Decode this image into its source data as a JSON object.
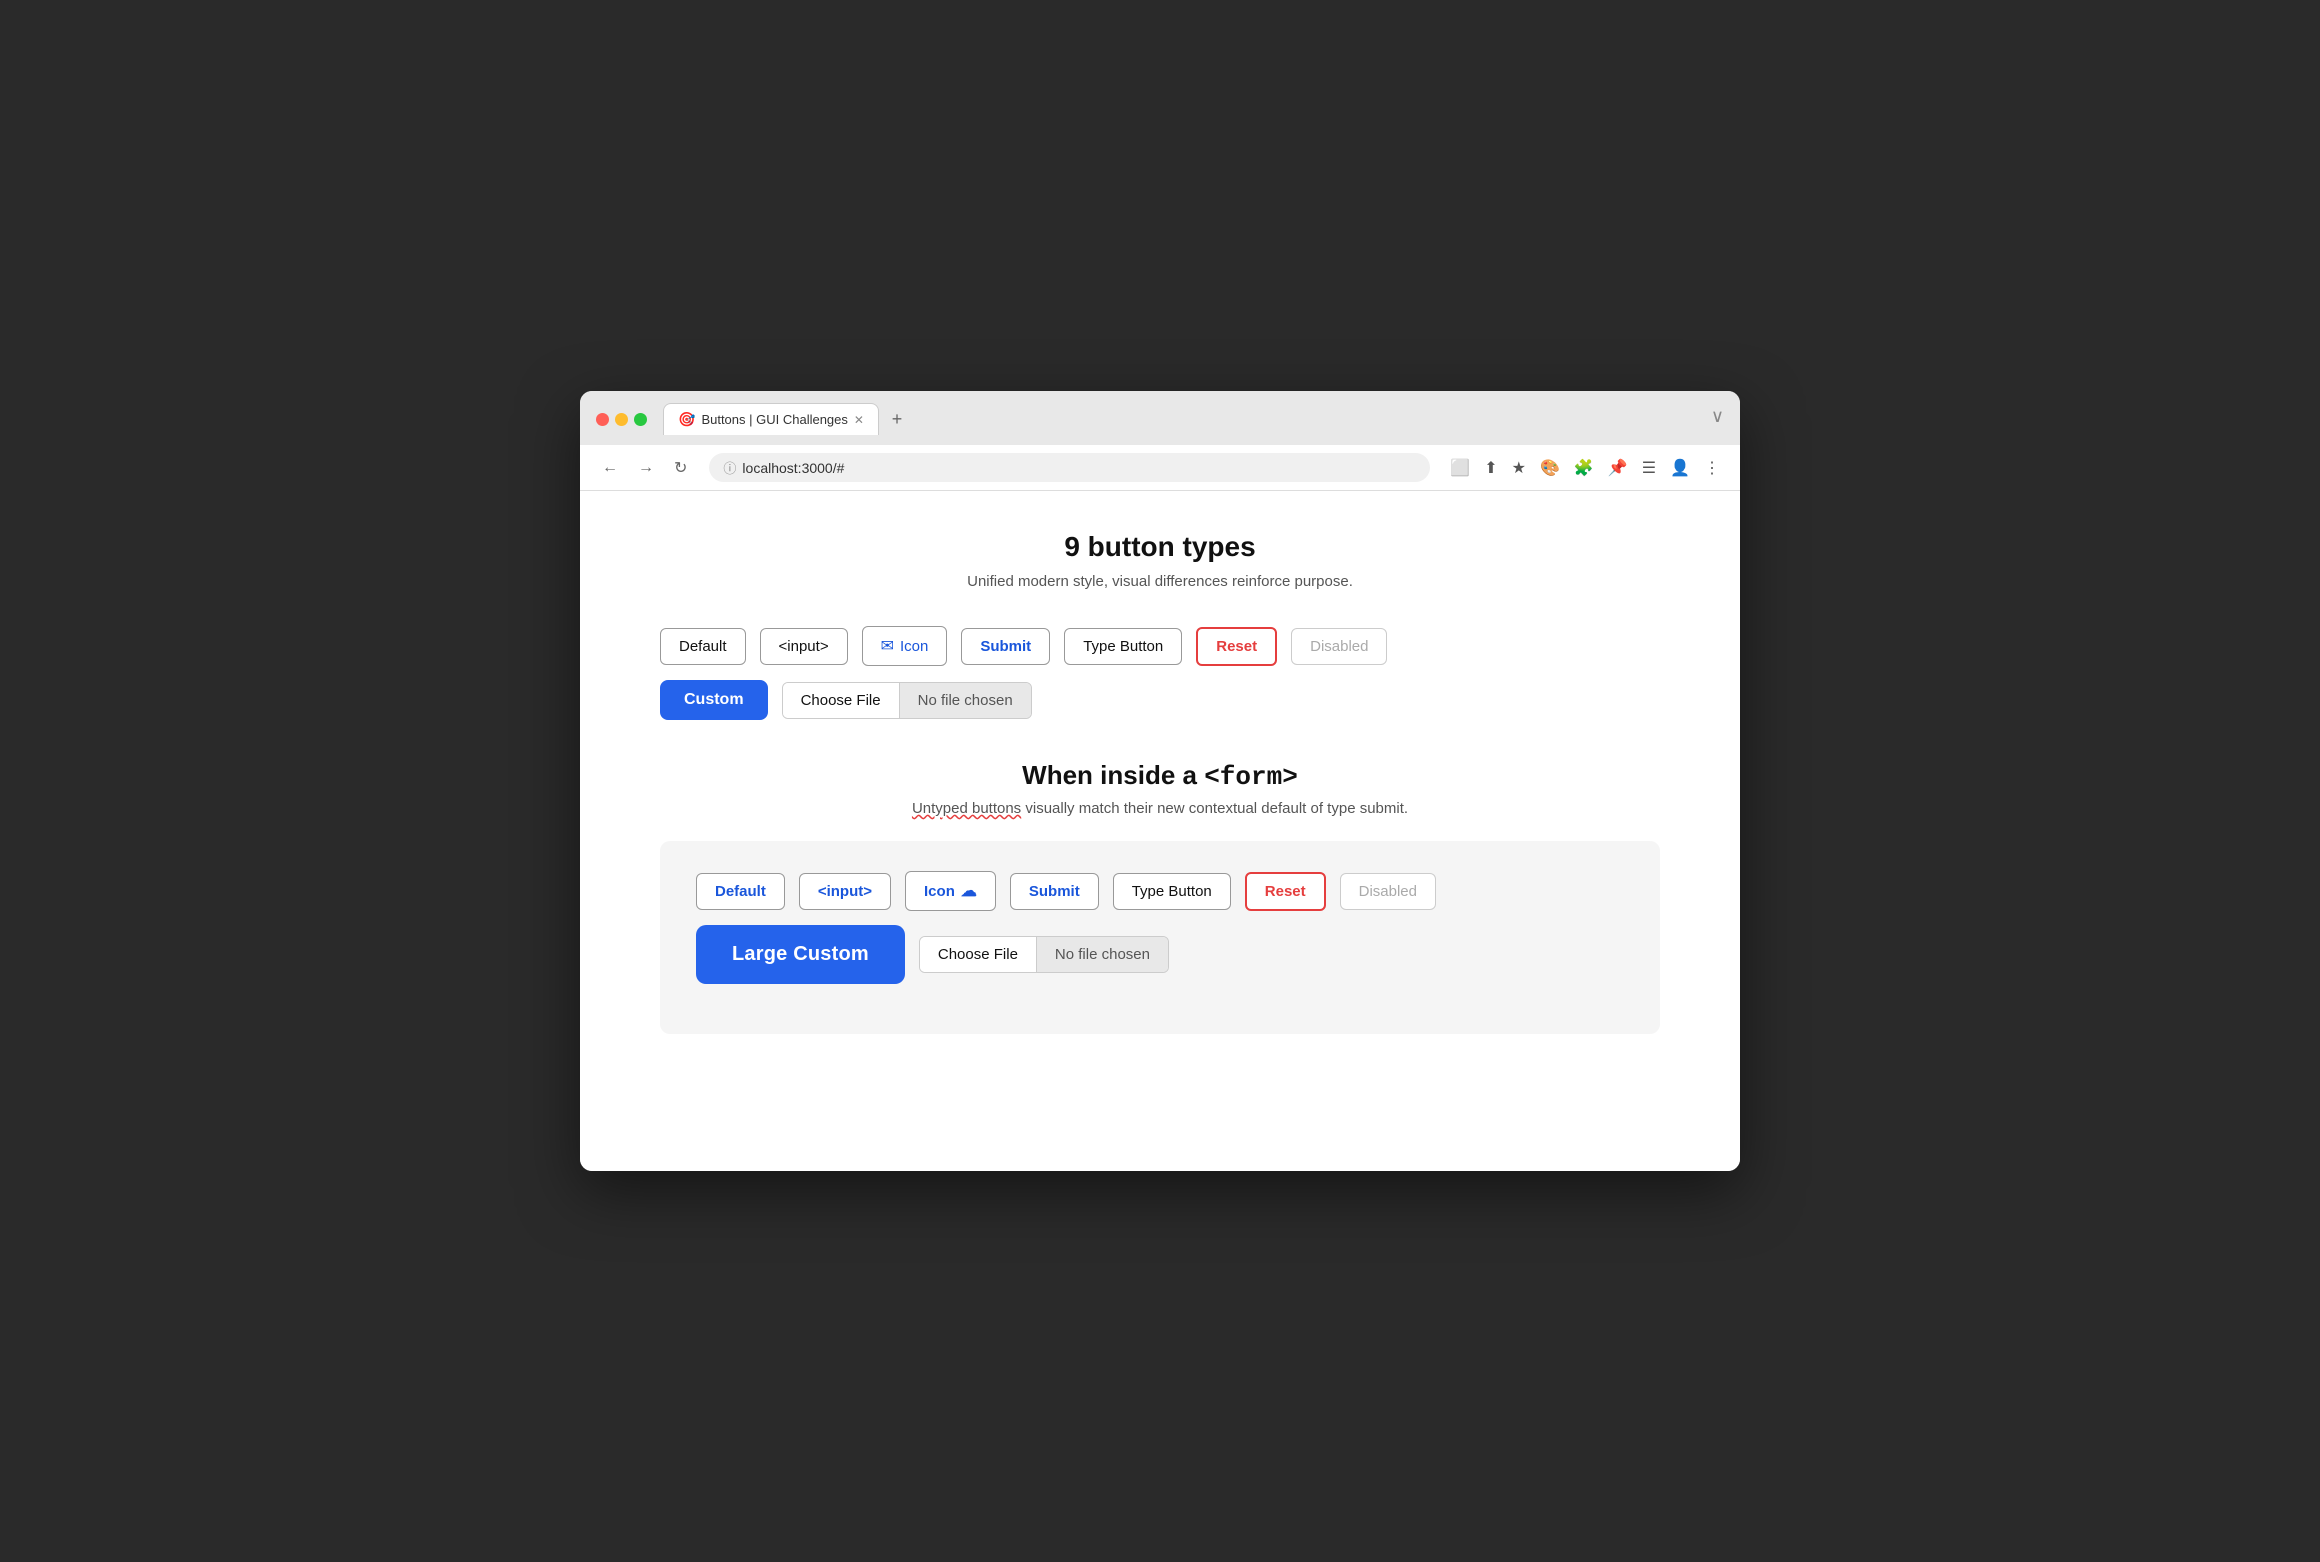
{
  "browser": {
    "tab_title": "Buttons | GUI Challenges",
    "tab_icon": "🎯",
    "address": "localhost:3000/#",
    "tab_close": "✕",
    "tab_new": "+",
    "nav": {
      "back": "←",
      "forward": "→",
      "reload": "↻",
      "actions": [
        "⬜",
        "⬆",
        "★",
        "🎨",
        "🧩",
        "📌",
        "☰",
        "👤",
        "⋮"
      ]
    }
  },
  "page": {
    "title": "9 button types",
    "subtitle": "Unified modern style, visual differences reinforce purpose.",
    "section2_title_prefix": "When inside a ",
    "section2_title_code": "<form>",
    "section2_subtitle_plain": " visually match their new contextual default of type submit.",
    "section2_subtitle_wavy": "Untyped buttons",
    "buttons_row1": [
      {
        "label": "Default",
        "type": "default"
      },
      {
        "label": "<input>",
        "type": "input"
      },
      {
        "label": "Icon",
        "type": "icon"
      },
      {
        "label": "Submit",
        "type": "submit"
      },
      {
        "label": "Type Button",
        "type": "type-button"
      },
      {
        "label": "Reset",
        "type": "reset"
      },
      {
        "label": "Disabled",
        "type": "disabled"
      }
    ],
    "custom_button": "Custom",
    "file_choose": "Choose File",
    "file_no_chosen": "No file chosen",
    "large_custom_button": "Large Custom",
    "file_choose2": "Choose File",
    "file_no_chosen2": "No file chosen",
    "form_buttons_row1": [
      {
        "label": "Default",
        "type": "default"
      },
      {
        "label": "<input>",
        "type": "input"
      },
      {
        "label": "Icon",
        "type": "icon"
      },
      {
        "label": "Submit",
        "type": "submit"
      },
      {
        "label": "Type Button",
        "type": "type-button"
      },
      {
        "label": "Reset",
        "type": "reset"
      },
      {
        "label": "Disabled",
        "type": "disabled"
      }
    ]
  }
}
